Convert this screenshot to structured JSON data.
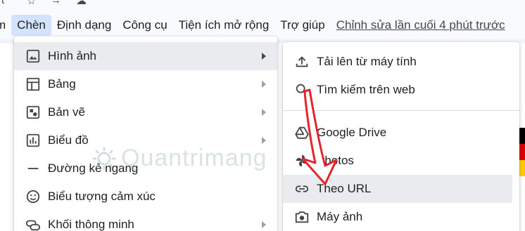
{
  "top_fragments": [
    "t",
    "☆",
    "→",
    "☁"
  ],
  "menubar": {
    "items": [
      {
        "label": "m",
        "active": false
      },
      {
        "label": "Chèn",
        "active": true
      },
      {
        "label": "Định dạng",
        "active": false
      },
      {
        "label": "Công cụ",
        "active": false
      },
      {
        "label": "Tiện ích mở rộng",
        "active": false
      },
      {
        "label": "Trợ giúp",
        "active": false
      }
    ],
    "last_edit": "Chỉnh sửa lần cuối 4 phút trước"
  },
  "insert_menu": {
    "items": [
      {
        "label": "Hình ảnh",
        "icon": "image-icon",
        "submenu": true
      },
      {
        "label": "Bảng",
        "icon": "table-icon",
        "submenu": true
      },
      {
        "label": "Bản vẽ",
        "icon": "drawing-icon",
        "submenu": true
      },
      {
        "label": "Biểu đồ",
        "icon": "chart-icon",
        "submenu": true
      },
      {
        "label": "Đường kẻ ngang",
        "icon": "horizontal-line-icon",
        "submenu": false
      },
      {
        "label": "Biểu tượng cảm xúc",
        "icon": "emoji-icon",
        "submenu": false
      },
      {
        "label": "Khối thông minh",
        "icon": "smart-chips-icon",
        "submenu": true
      }
    ]
  },
  "image_submenu": {
    "items": [
      {
        "label": "Tải lên từ máy tính",
        "icon": "upload-icon"
      },
      {
        "label": "Tìm kiếm trên web",
        "icon": "search-icon"
      },
      {
        "label": "Google Drive",
        "icon": "google-drive-icon"
      },
      {
        "label": "Photos",
        "icon": "google-photos-icon"
      },
      {
        "label": "Theo URL",
        "icon": "link-icon"
      },
      {
        "label": "Máy ảnh",
        "icon": "camera-icon"
      }
    ]
  },
  "watermark": "Quantrimang",
  "colors": {
    "menu_active_bg": "#d3e3fd",
    "item_hover_bg": "#e9ebef",
    "annotation_red": "#e3262b",
    "text": "#1f1f1f",
    "icon": "#444746"
  }
}
